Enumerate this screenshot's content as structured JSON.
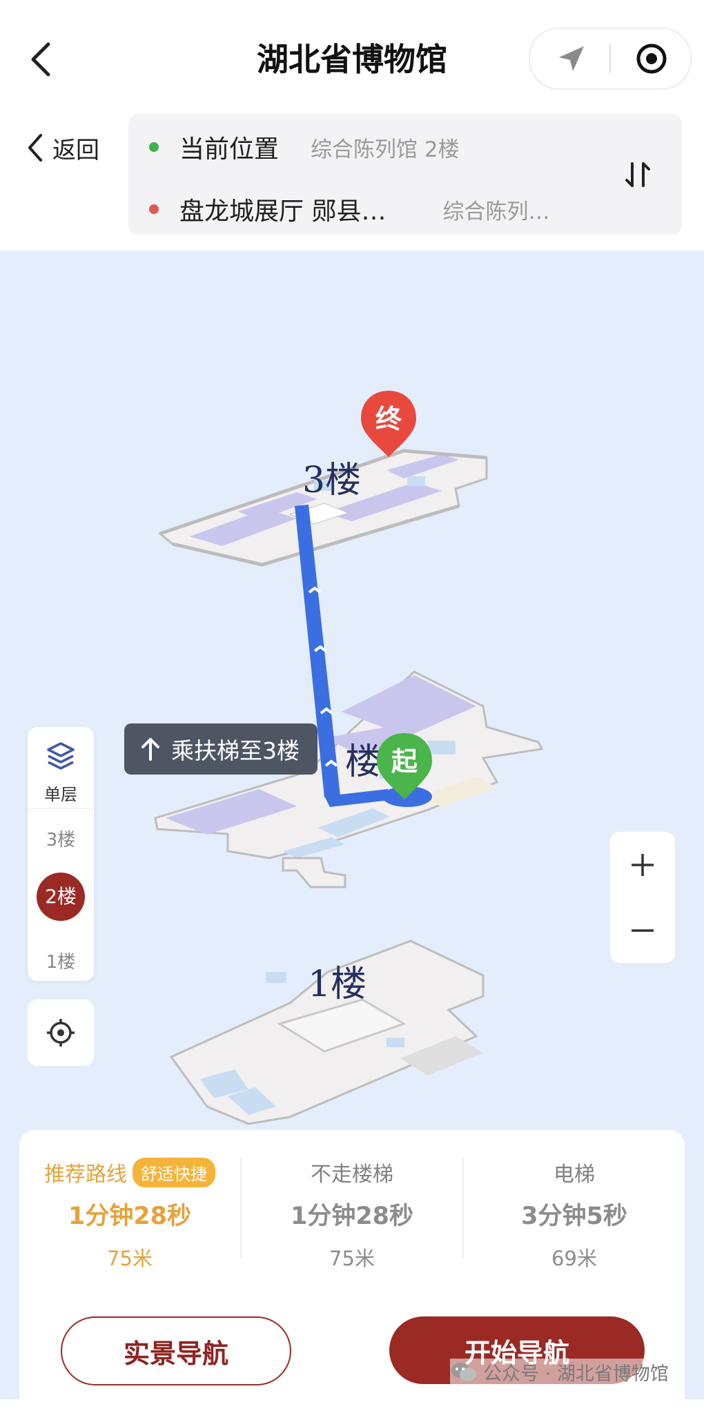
{
  "header": {
    "title": "湖北省博物馆"
  },
  "route": {
    "back_label": "返回",
    "origin": {
      "name": "当前位置",
      "detail": "综合陈列馆 2楼",
      "dot_color": "#3cb34b"
    },
    "destination": {
      "name": "盘龙城展厅 郧县…",
      "detail": "综合陈列…",
      "dot_color": "#e05a55"
    }
  },
  "map": {
    "floor_labels": {
      "third": "3楼",
      "second": "楼",
      "first": "1楼"
    },
    "end_pin": "终",
    "start_pin": "起",
    "escalator_tip": "乘扶梯至3楼",
    "route_color": "#3b6ee0",
    "floor_switch": {
      "layers_label": "单层",
      "floors": [
        "3楼",
        "2楼",
        "1楼"
      ],
      "active": "2楼"
    }
  },
  "options": [
    {
      "title": "推荐路线",
      "badge": "舒适快捷",
      "time": "1分钟28秒",
      "distance": "75米"
    },
    {
      "title": "不走楼梯",
      "time": "1分钟28秒",
      "distance": "75米"
    },
    {
      "title": "电梯",
      "time": "3分钟5秒",
      "distance": "69米"
    }
  ],
  "actions": {
    "ar_nav": "实景导航",
    "start_nav": "开始导航"
  },
  "watermark": "公众号 · 湖北省博物馆",
  "colors": {
    "brand": "#9b2a24",
    "highlight": "#e6a23c",
    "map_bg": "#e4edfb"
  }
}
